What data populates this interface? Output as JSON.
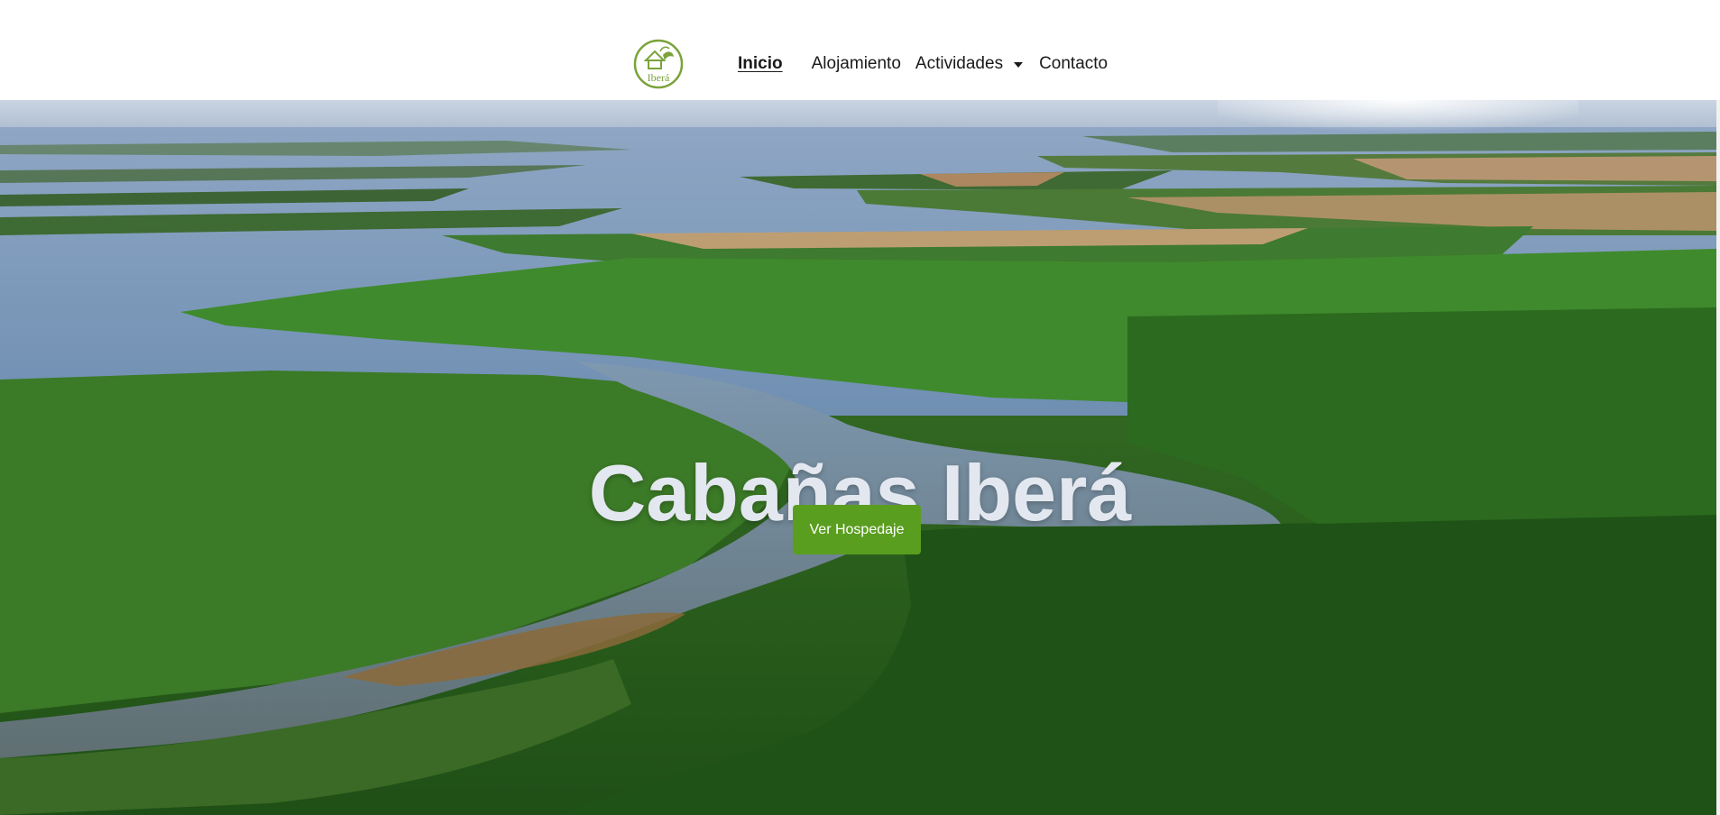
{
  "header": {
    "logo_text": "Iberá",
    "nav": {
      "inicio": "Inicio",
      "alojamiento": "Alojamiento",
      "actividades": "Actividades",
      "contacto": "Contacto"
    }
  },
  "hero": {
    "title": "Cabañas Iberá",
    "cta_label": "Ver Hospedaje",
    "background": "aerial-wetland-river-landscape"
  },
  "colors": {
    "accent": "#5a9e1f",
    "logo_green": "#7aa33a",
    "title_text": "#e3e7ef"
  }
}
